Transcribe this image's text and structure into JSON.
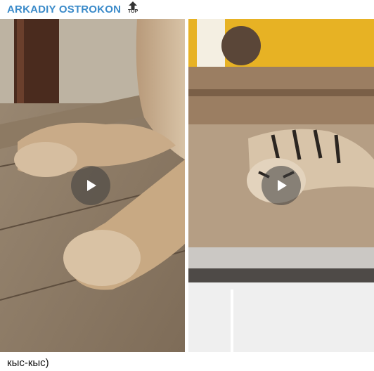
{
  "post": {
    "author": "ARKADIY OSTROKON",
    "top_badge": "TOP",
    "caption": "кыс-кыс)"
  },
  "media": [
    {
      "kind": "video",
      "icon": "play-icon"
    },
    {
      "kind": "video",
      "icon": "play-icon"
    }
  ],
  "colors": {
    "author": "#3a8ac9",
    "play_overlay": "rgba(60,60,60,0.55)",
    "wall": "#e7b224"
  }
}
